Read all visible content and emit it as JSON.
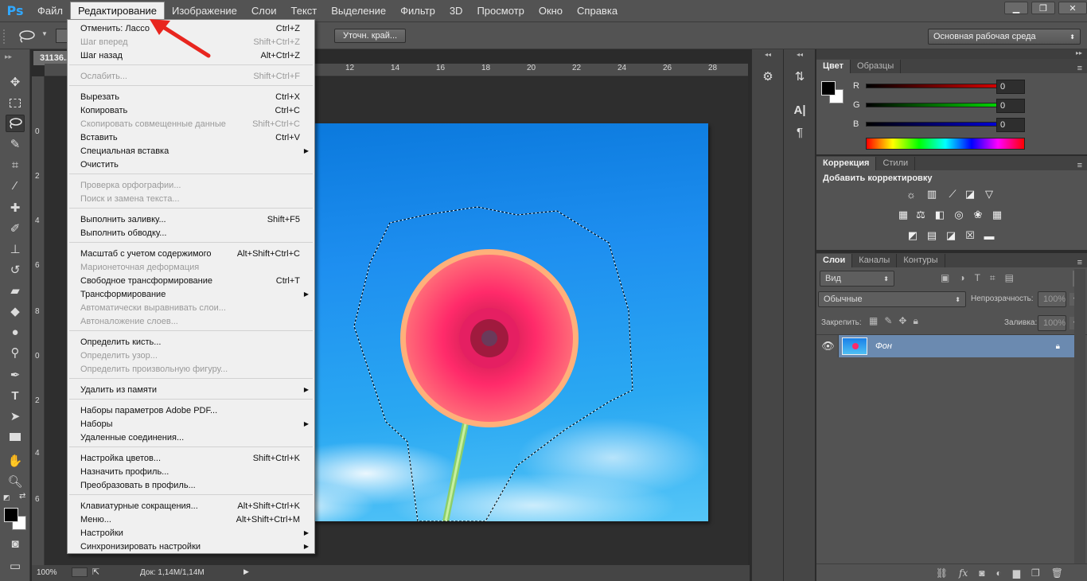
{
  "app": {
    "logo": "Ps"
  },
  "menubar": {
    "items": [
      "Файл",
      "Редактирование",
      "Изображение",
      "Слои",
      "Текст",
      "Выделение",
      "Фильтр",
      "3D",
      "Просмотр",
      "Окно",
      "Справка"
    ],
    "active_index": 1,
    "window_controls": [
      "minimize-icon",
      "restore-icon",
      "close-icon"
    ]
  },
  "options": {
    "refine_edge": "Уточн. край...",
    "workspace": "Основная рабочая среда"
  },
  "document": {
    "tab_title": "31136...",
    "ruler_top": [
      "12",
      "14",
      "16",
      "18",
      "20",
      "22",
      "24",
      "26",
      "28"
    ],
    "ruler_left": [
      "0",
      "2",
      "4",
      "6",
      "8",
      "0",
      "2",
      "4",
      "6"
    ],
    "zoom": "100%",
    "doc_size": "Док: 1,14M/1,14M"
  },
  "edit_menu": {
    "items": [
      {
        "label": "Отменить: Лассо",
        "shortcut": "Ctrl+Z",
        "disabled": false
      },
      {
        "label": "Шаг вперед",
        "shortcut": "Shift+Ctrl+Z",
        "disabled": true
      },
      {
        "label": "Шаг назад",
        "shortcut": "Alt+Ctrl+Z",
        "disabled": false
      },
      {
        "label": "Ослабить...",
        "shortcut": "Shift+Ctrl+F",
        "disabled": true
      },
      {
        "label": "Вырезать",
        "shortcut": "Ctrl+X",
        "disabled": false
      },
      {
        "label": "Копировать",
        "shortcut": "Ctrl+C",
        "disabled": false
      },
      {
        "label": "Скопировать совмещенные данные",
        "shortcut": "Shift+Ctrl+C",
        "disabled": true
      },
      {
        "label": "Вставить",
        "shortcut": "Ctrl+V",
        "disabled": false
      },
      {
        "label": "Специальная вставка",
        "shortcut": "",
        "disabled": false,
        "submenu": true
      },
      {
        "label": "Очистить",
        "shortcut": "",
        "disabled": false
      },
      {
        "label": "Проверка орфографии...",
        "shortcut": "",
        "disabled": true
      },
      {
        "label": "Поиск и замена текста...",
        "shortcut": "",
        "disabled": true
      },
      {
        "label": "Выполнить заливку...",
        "shortcut": "Shift+F5",
        "disabled": false
      },
      {
        "label": "Выполнить обводку...",
        "shortcut": "",
        "disabled": false
      },
      {
        "label": "Масштаб с учетом содержимого",
        "shortcut": "Alt+Shift+Ctrl+C",
        "disabled": false
      },
      {
        "label": "Марионеточная деформация",
        "shortcut": "",
        "disabled": true
      },
      {
        "label": "Свободное трансформирование",
        "shortcut": "Ctrl+T",
        "disabled": false
      },
      {
        "label": "Трансформирование",
        "shortcut": "",
        "disabled": false,
        "submenu": true
      },
      {
        "label": "Автоматически выравнивать слои...",
        "shortcut": "",
        "disabled": true
      },
      {
        "label": "Автоналожение слоев...",
        "shortcut": "",
        "disabled": true
      },
      {
        "label": "Определить кисть...",
        "shortcut": "",
        "disabled": false
      },
      {
        "label": "Определить узор...",
        "shortcut": "",
        "disabled": true
      },
      {
        "label": "Определить произвольную фигуру...",
        "shortcut": "",
        "disabled": true
      },
      {
        "label": "Удалить из памяти",
        "shortcut": "",
        "disabled": false,
        "submenu": true
      },
      {
        "label": "Наборы параметров Adobe PDF...",
        "shortcut": "",
        "disabled": false
      },
      {
        "label": "Наборы",
        "shortcut": "",
        "disabled": false,
        "submenu": true
      },
      {
        "label": "Удаленные соединения...",
        "shortcut": "",
        "disabled": false
      },
      {
        "label": "Настройка цветов...",
        "shortcut": "Shift+Ctrl+K",
        "disabled": false
      },
      {
        "label": "Назначить профиль...",
        "shortcut": "",
        "disabled": false
      },
      {
        "label": "Преобразовать в профиль...",
        "shortcut": "",
        "disabled": false
      },
      {
        "label": "Клавиатурные сокращения...",
        "shortcut": "Alt+Shift+Ctrl+K",
        "disabled": false
      },
      {
        "label": "Меню...",
        "shortcut": "Alt+Shift+Ctrl+M",
        "disabled": false
      },
      {
        "label": "Настройки",
        "shortcut": "",
        "disabled": false,
        "submenu": true
      },
      {
        "label": "Синхронизировать настройки",
        "shortcut": "",
        "disabled": false,
        "submenu": true
      }
    ]
  },
  "color_panel": {
    "tabs": [
      "Цвет",
      "Образцы"
    ],
    "channels": [
      {
        "label": "R",
        "value": "0",
        "color": "#e02020"
      },
      {
        "label": "G",
        "value": "0",
        "color": "#20c020"
      },
      {
        "label": "B",
        "value": "0",
        "color": "#2040e0"
      }
    ]
  },
  "adjustments_panel": {
    "tabs": [
      "Коррекция",
      "Стили"
    ],
    "heading": "Добавить корректировку"
  },
  "layers_panel": {
    "tabs": [
      "Слои",
      "Каналы",
      "Контуры"
    ],
    "filter": "Вид",
    "blend_mode": "Обычные",
    "opacity_label": "Непрозрачность:",
    "opacity_value": "100%",
    "lock_label": "Закрепить:",
    "fill_label": "Заливка:",
    "fill_value": "100%",
    "layers": [
      {
        "name": "Фон"
      }
    ]
  },
  "colors": {
    "accent": "#31a8ff",
    "selection_highlight": "#6b8ab0",
    "arrow": "#e8261f"
  }
}
